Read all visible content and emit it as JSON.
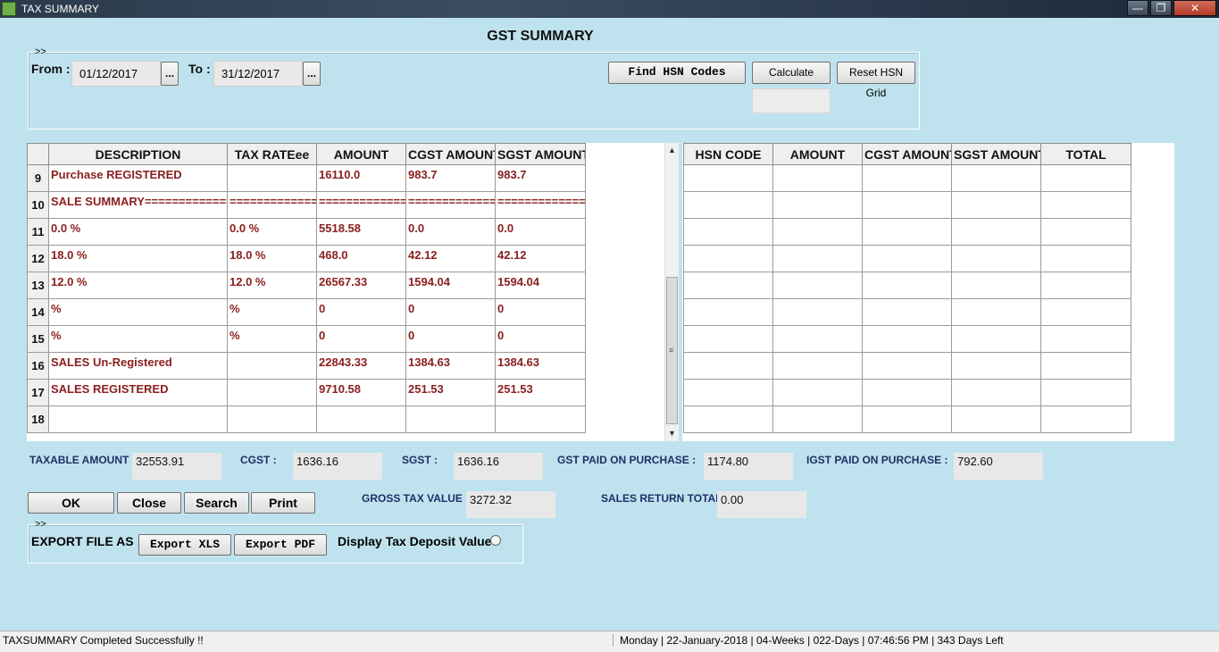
{
  "window": {
    "title": "TAX SUMMARY",
    "min": "—",
    "max": "❐",
    "close": "✕"
  },
  "page": {
    "heading": "GST SUMMARY"
  },
  "date_group": {
    "toggle": ">>",
    "from_label": "From :",
    "from_value": "01/12/2017",
    "to_label": "To :",
    "to_value": "31/12/2017",
    "picker": "..."
  },
  "actions": {
    "find_hsn": "Find HSN Codes",
    "calculate": "Calculate",
    "reset_hsn": "Reset HSN Grid"
  },
  "summary_grid": {
    "columns": [
      "DESCRIPTION",
      "TAX RATEee",
      "AMOUNT",
      "CGST AMOUNT",
      "SGST AMOUNT"
    ],
    "rows": [
      {
        "num": "9",
        "cells": [
          "Purchase REGISTERED",
          "",
          "16110.0",
          "983.7",
          "983.7"
        ]
      },
      {
        "num": "10",
        "cells": [
          "SALE SUMMARY==================",
          "================",
          "================",
          "================",
          "================"
        ]
      },
      {
        "num": "11",
        "cells": [
          "0.0 %",
          "0.0 %",
          "5518.58",
          "0.0",
          "0.0"
        ]
      },
      {
        "num": "12",
        "cells": [
          "18.0 %",
          "18.0 %",
          "468.0",
          "42.12",
          "42.12"
        ]
      },
      {
        "num": "13",
        "cells": [
          "12.0 %",
          "12.0 %",
          "26567.33",
          "1594.04",
          "1594.04"
        ]
      },
      {
        "num": "14",
        "cells": [
          " %",
          "%",
          "0",
          "0",
          "0"
        ]
      },
      {
        "num": "15",
        "cells": [
          " %",
          "%",
          "0",
          "0",
          "0"
        ]
      },
      {
        "num": "16",
        "cells": [
          "SALES Un-Registered",
          "",
          "22843.33",
          "1384.63",
          "1384.63"
        ]
      },
      {
        "num": "17",
        "cells": [
          "SALES REGISTERED",
          "",
          "9710.58",
          "251.53",
          "251.53"
        ]
      },
      {
        "num": "18",
        "cells": [
          "",
          "",
          "",
          "",
          ""
        ]
      }
    ]
  },
  "hsn_grid": {
    "columns": [
      "HSN CODE",
      "AMOUNT",
      "CGST AMOUNT",
      "SGST AMOUNT",
      "TOTAL"
    ],
    "row_count": 10
  },
  "totals": {
    "taxable_label": "TAXABLE AMOUNT :",
    "taxable_value": "32553.91",
    "cgst_label": "CGST :",
    "cgst_value": "1636.16",
    "sgst_label": "SGST :",
    "sgst_value": "1636.16",
    "gst_paid_label": "GST PAID ON PURCHASE :",
    "gst_paid_value": "1174.80",
    "igst_paid_label": "IGST PAID ON PURCHASE :",
    "igst_paid_value": "792.60",
    "gross_label": "GROSS TAX VALUE :",
    "gross_value": "3272.32",
    "sales_return_label": "SALES RETURN TOTAL:",
    "sales_return_value": "0.00"
  },
  "buttons": {
    "ok": "OK",
    "close": "Close",
    "search": "Search",
    "print": "Print"
  },
  "export": {
    "toggle": ">>",
    "label": "EXPORT FILE AS :",
    "xls": "Export XLS",
    "pdf": "Export PDF",
    "deposit_label": "Display Tax Deposit Value-"
  },
  "status": {
    "message": "TAXSUMMARY Completed Successfully !!",
    "info": "Monday |  22-January-2018  | 04-Weeks  | 022-Days  | 07:46:56 PM  | 343 Days Left"
  }
}
